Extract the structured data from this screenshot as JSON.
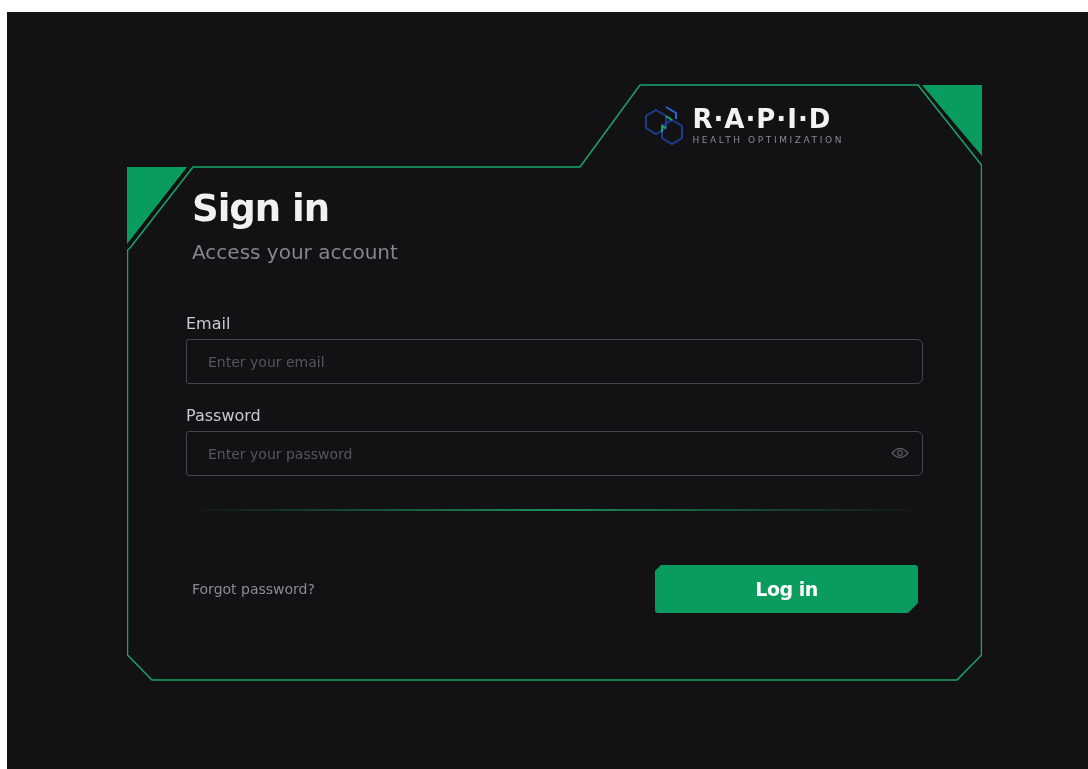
{
  "logo": {
    "name": "R·A·P·I·D",
    "tagline": "HEALTH OPTIMIZATION"
  },
  "title": "Sign in",
  "subtitle": "Access your account",
  "fields": [
    {
      "label": "Email",
      "placeholder": "Enter your email",
      "kind": "text"
    },
    {
      "label": "Password",
      "placeholder": "Enter your password",
      "kind": "password"
    }
  ],
  "forgot_link": "Forgot password?",
  "login_button": "Log in"
}
